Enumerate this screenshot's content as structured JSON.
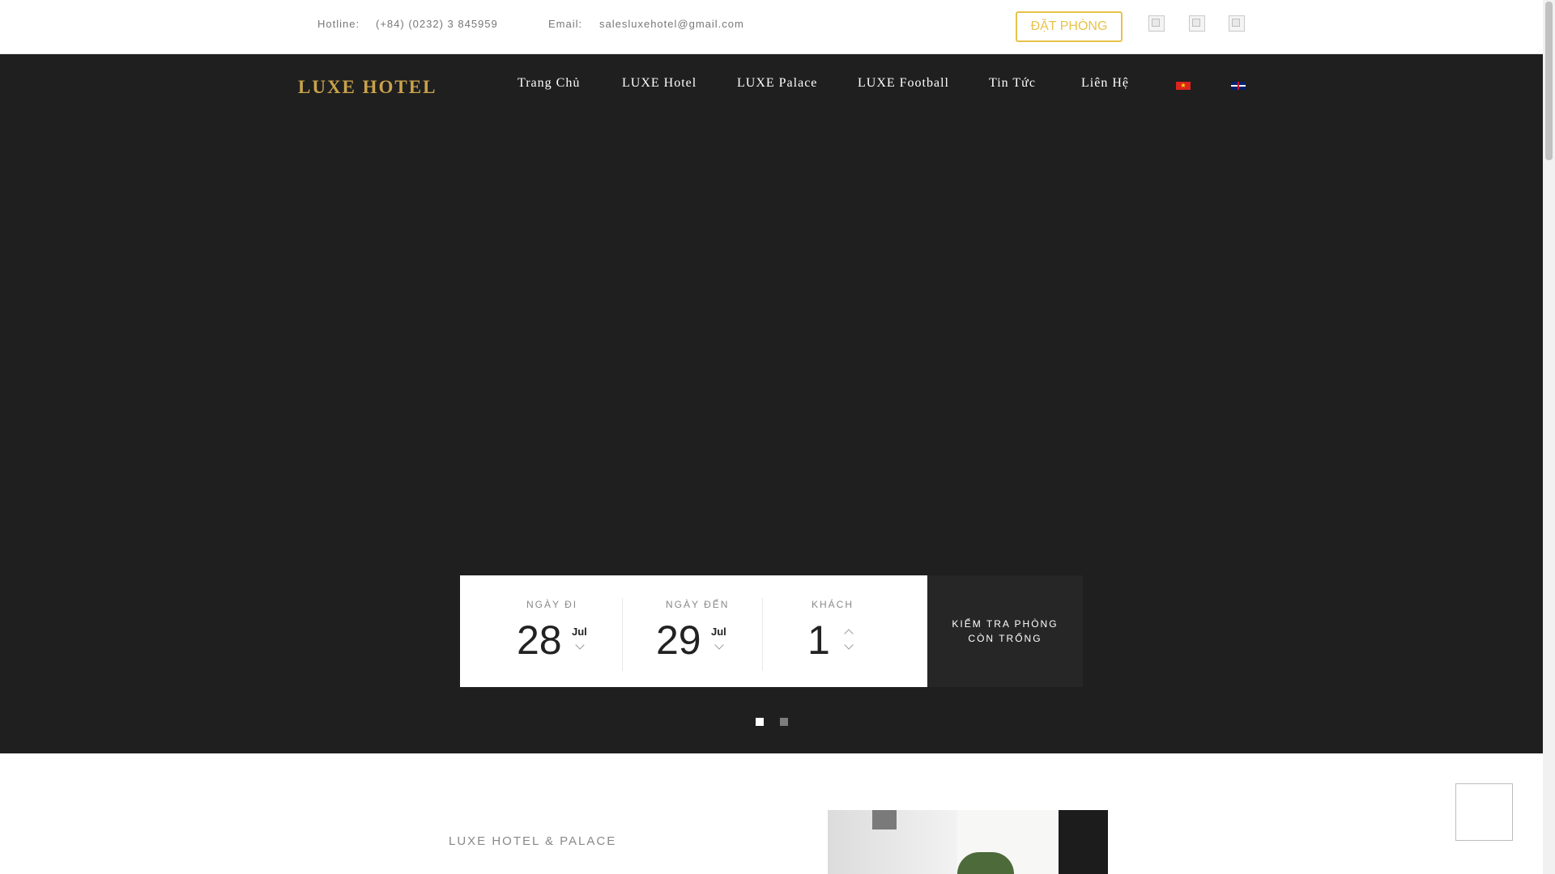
{
  "topbar": {
    "hotline_label": "Hotline:",
    "hotline_value": "(+84) (0232) 3 845959",
    "email_label": "Email:",
    "email_value": "salesluxehotel@gmail.com",
    "book_label": "ĐẶT PHÒNG",
    "social_icons": [
      "social-icon-1",
      "social-icon-2",
      "social-icon-3"
    ]
  },
  "header": {
    "logo": "LUXE HOTEL",
    "nav": [
      {
        "label": "Trang Chủ"
      },
      {
        "label": "LUXE Hotel"
      },
      {
        "label": "LUXE Palace"
      },
      {
        "label": "LUXE Football"
      },
      {
        "label": "Tin Tức"
      },
      {
        "label": "Liên Hệ"
      }
    ],
    "languages": [
      "vietnamese-flag-icon",
      "english-flag-icon"
    ]
  },
  "booking": {
    "checkin": {
      "label": "NGÀY ĐI",
      "day": "28",
      "month": "Jul"
    },
    "checkout": {
      "label": "NGÀY ĐẾN",
      "day": "29",
      "month": "Jul"
    },
    "guests": {
      "label": "KHÁCH",
      "value": "1"
    },
    "check_label_line1": "KIỂM TRA PHÒNG",
    "check_label_line2": "CÒN TRỐNG"
  },
  "slider": {
    "current": 1,
    "total": 2
  },
  "section": {
    "title": "LUXE HOTEL & PALACE"
  },
  "colors": {
    "accent": "#e7c24a",
    "logo": "#c9a24b",
    "hero_bg": "#1f1f1f"
  }
}
